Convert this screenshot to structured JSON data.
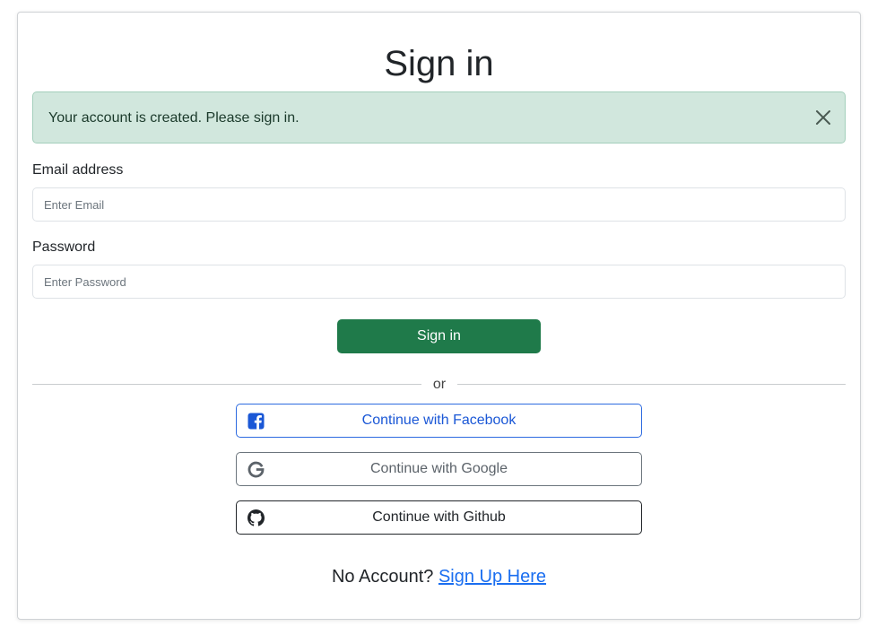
{
  "page": {
    "title": "Sign in"
  },
  "alert": {
    "message": "Your account is created. Please sign in.",
    "close_icon": "close-icon"
  },
  "form": {
    "email_label": "Email address",
    "email_placeholder": "Enter Email",
    "email_value": "",
    "password_label": "Password",
    "password_placeholder": "Enter Password",
    "password_value": "",
    "submit_label": "Sign in"
  },
  "divider": {
    "text": "or"
  },
  "social": [
    {
      "label": "Continue with Facebook",
      "icon": "facebook-icon",
      "color": "#1a57d6"
    },
    {
      "label": "Continue with Google",
      "icon": "google-icon",
      "color": "#5c636a"
    },
    {
      "label": "Continue with Github",
      "icon": "github-icon",
      "color": "#212529"
    }
  ],
  "footer": {
    "prompt": "No Account?",
    "link_text": "Sign Up Here"
  },
  "colors": {
    "primary_button": "#1f7a4a",
    "alert_background": "#d1e7dd",
    "link": "#1a6ef0"
  }
}
